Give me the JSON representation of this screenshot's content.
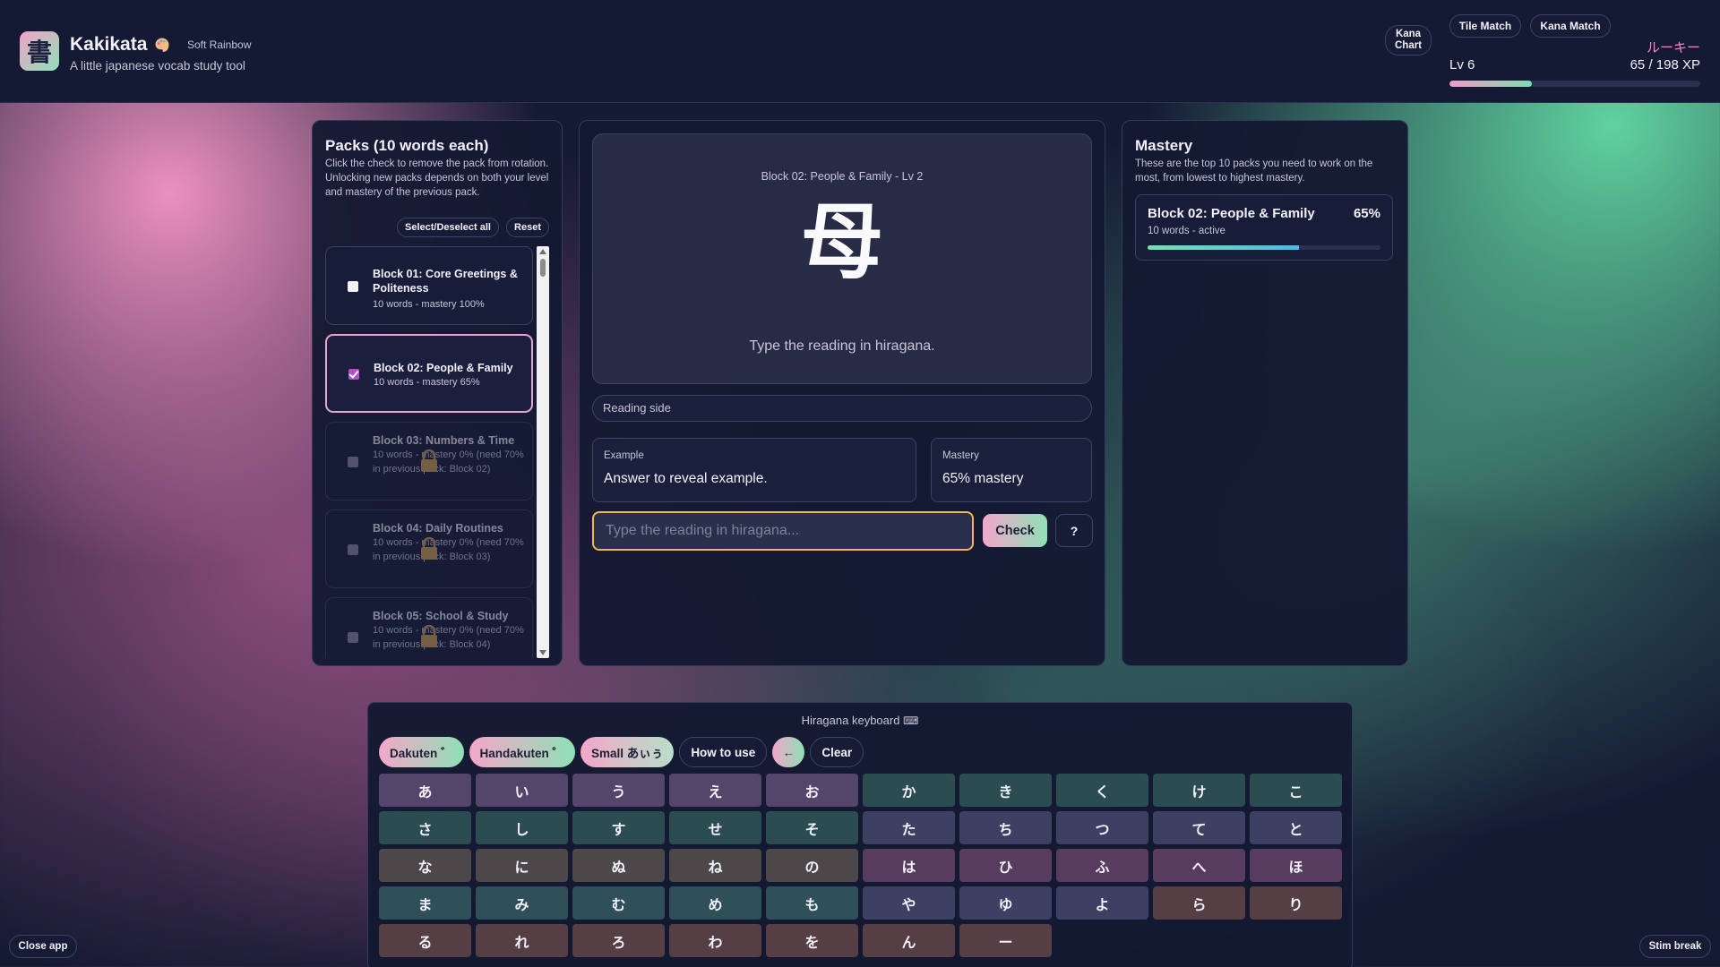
{
  "header": {
    "logo_glyph": "書",
    "title": "Kakikata",
    "theme_name": "Soft Rainbow",
    "subtitle": "A little japanese vocab study tool",
    "nav": {
      "kana_chart": "Kana Chart",
      "tile_match": "Tile Match",
      "kana_match": "Kana Match"
    },
    "rank": "ルーキー",
    "level": "Lv 6",
    "xp": "65 / 198 XP",
    "xp_progress_percent": 33
  },
  "packs": {
    "title": "Packs (10 words each)",
    "description": "Click the check to remove the pack from rotation. Unlocking new packs depends on both your level and mastery of the previous pack.",
    "select_all_label": "Select/Deselect all",
    "reset_label": "Reset",
    "items": [
      {
        "name": "Block 01: Core Greetings & Politeness",
        "meta": "10 words - mastery 100%",
        "state": "unchecked"
      },
      {
        "name": "Block 02: People & Family",
        "meta": "10 words - mastery 65%",
        "state": "checked"
      },
      {
        "name": "Block 03: Numbers & Time",
        "meta": "10 words - mastery 0% (need 70% in previous pack: Block 02)",
        "state": "locked"
      },
      {
        "name": "Block 04: Daily Routines",
        "meta": "10 words - mastery 0% (need 70% in previous pack: Block 03)",
        "state": "locked"
      },
      {
        "name": "Block 05: School & Study",
        "meta": "10 words - mastery 0% (need 70% in previous pack: Block 04)",
        "state": "locked"
      }
    ]
  },
  "study": {
    "card_header": "Block 02: People & Family - Lv 2",
    "kanji": "母",
    "prompt": "Type the reading in hiragana.",
    "side_label": "Reading side",
    "example_label": "Example",
    "example_value": "Answer to reveal example.",
    "mastery_label": "Mastery",
    "mastery_value": "65% mastery",
    "input_placeholder": "Type the reading in hiragana...",
    "input_value": "",
    "check_label": "Check",
    "help_label": "?"
  },
  "mastery": {
    "title": "Mastery",
    "description": "These are the top 10 packs you need to work on the most, from lowest to highest mastery.",
    "items": [
      {
        "name": "Block 02: People & Family",
        "percent": "65%",
        "meta": "10 words - active",
        "progress_percent": 65
      }
    ]
  },
  "keyboard": {
    "title": "Hiragana keyboard",
    "icon": "keyboard-icon",
    "toolbar": {
      "dakuten": "Dakuten ゛",
      "handakuten": "Handakuten ゜",
      "small": "Small あぃぅ",
      "how_to_use": "How to use",
      "backspace": "←",
      "clear": "Clear"
    },
    "keys": [
      "あ",
      "い",
      "う",
      "え",
      "お",
      "か",
      "き",
      "く",
      "け",
      "こ",
      "さ",
      "し",
      "す",
      "せ",
      "そ",
      "た",
      "ち",
      "つ",
      "て",
      "と",
      "な",
      "に",
      "ぬ",
      "ね",
      "の",
      "は",
      "ひ",
      "ふ",
      "へ",
      "ほ",
      "ま",
      "み",
      "む",
      "め",
      "も",
      "や",
      "ゆ",
      "よ",
      "ら",
      "り",
      "る",
      "れ",
      "ろ",
      "わ",
      "を",
      "ん",
      "ー"
    ]
  },
  "footer": {
    "close_app": "Close app",
    "stim_break": "Stim break"
  },
  "colors": {
    "accent_pink": "#f3a7c8",
    "accent_mint": "#8fe0b6",
    "rank_pink": "#f08abf",
    "input_focus": "#f0b64f",
    "checked_purple": "#b34fc9"
  }
}
